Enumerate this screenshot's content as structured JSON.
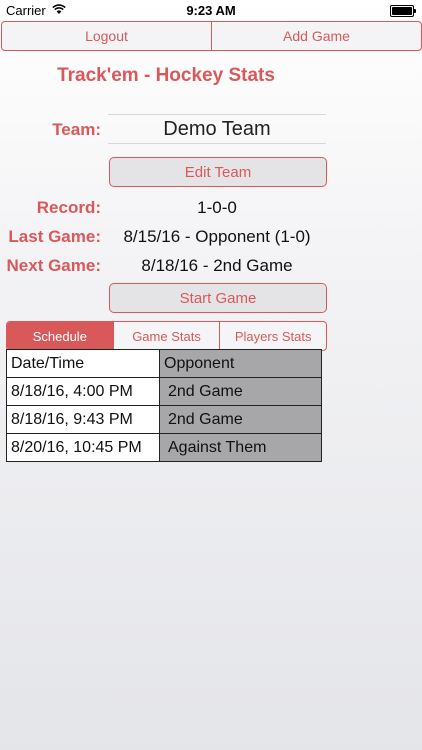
{
  "status_bar": {
    "carrier": "Carrier",
    "time": "9:23 AM",
    "battery_level": 1.0
  },
  "topbar": {
    "logout_label": "Logout",
    "add_game_label": "Add Game"
  },
  "title": "Track'em - Hockey Stats",
  "team": {
    "label": "Team:",
    "value": "Demo Team"
  },
  "edit_team_label": "Edit Team",
  "record": {
    "label": "Record:",
    "value": "1-0-0"
  },
  "last_game": {
    "label": "Last Game:",
    "value": "8/15/16 - Opponent (1-0)"
  },
  "next_game": {
    "label": "Next Game:",
    "value": "8/18/16 - 2nd Game"
  },
  "start_game_label": "Start Game",
  "tabs": [
    {
      "label": "Schedule",
      "active": true
    },
    {
      "label": "Game Stats",
      "active": false
    },
    {
      "label": "Players Stats",
      "active": false
    }
  ],
  "schedule": {
    "headers": [
      "Date/Time",
      "Opponent"
    ],
    "rows": [
      [
        "8/18/16, 4:00 PM",
        "2nd Game"
      ],
      [
        "8/18/16, 9:43 PM",
        "2nd Game"
      ],
      [
        "8/20/16, 10:45 PM",
        "Against Them"
      ]
    ]
  },
  "colors": {
    "accent": "#d9595b",
    "cell_gray": "#a7a7a9"
  }
}
